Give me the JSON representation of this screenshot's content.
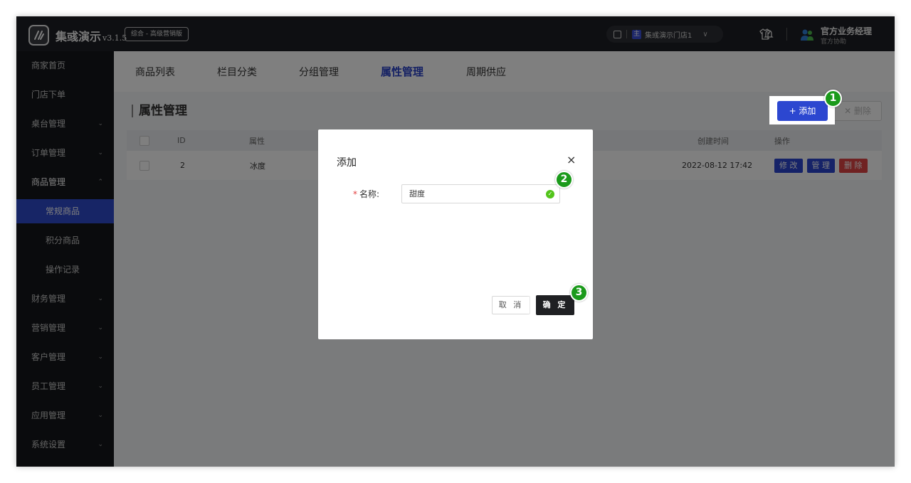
{
  "brand": {
    "name": "集彧演示",
    "version": "v3.1.5",
    "edition": "综合 - 高级营销版"
  },
  "topbar": {
    "store_name": "集彧演示门店1",
    "store_badge": "主",
    "user_name": "官方业务经理",
    "user_role": "官方协助"
  },
  "sidebar": {
    "items": [
      {
        "label": "商家首页",
        "arrow": ""
      },
      {
        "label": "门店下单",
        "arrow": ""
      },
      {
        "label": "桌台管理",
        "arrow": "⌄"
      },
      {
        "label": "订单管理",
        "arrow": "⌄"
      },
      {
        "label": "商品管理",
        "arrow": "⌃"
      },
      {
        "label": "常规商品",
        "arrow": ""
      },
      {
        "label": "积分商品",
        "arrow": ""
      },
      {
        "label": "操作记录",
        "arrow": ""
      },
      {
        "label": "财务管理",
        "arrow": "⌄"
      },
      {
        "label": "营销管理",
        "arrow": "⌄"
      },
      {
        "label": "客户管理",
        "arrow": "⌄"
      },
      {
        "label": "员工管理",
        "arrow": "⌄"
      },
      {
        "label": "应用管理",
        "arrow": "⌄"
      },
      {
        "label": "系统设置",
        "arrow": "⌄"
      }
    ]
  },
  "tabs": [
    "商品列表",
    "栏目分类",
    "分组管理",
    "属性管理",
    "周期供应"
  ],
  "page": {
    "title": "属性管理",
    "add_label": "+ 添加",
    "delete_label": "✕ 删除"
  },
  "table": {
    "columns": {
      "id": "ID",
      "attr": "属性",
      "created": "创建时间",
      "ops": "操作"
    },
    "rows": [
      {
        "id": "2",
        "attr": "冰度",
        "created": "2022-08-12 17:42",
        "edit": "修 改",
        "manage": "管 理",
        "delete": "删 除"
      }
    ]
  },
  "modal": {
    "title": "添加",
    "close": "×",
    "required_mark": "*",
    "name_label": "名称:",
    "name_value": "甜度",
    "cancel_label": "取 消",
    "ok_label": "确 定"
  },
  "steps": [
    "1",
    "2",
    "3"
  ],
  "colors": {
    "accent": "#2c47d0",
    "danger": "#e04444",
    "step_badge": "#1b9a1b"
  }
}
